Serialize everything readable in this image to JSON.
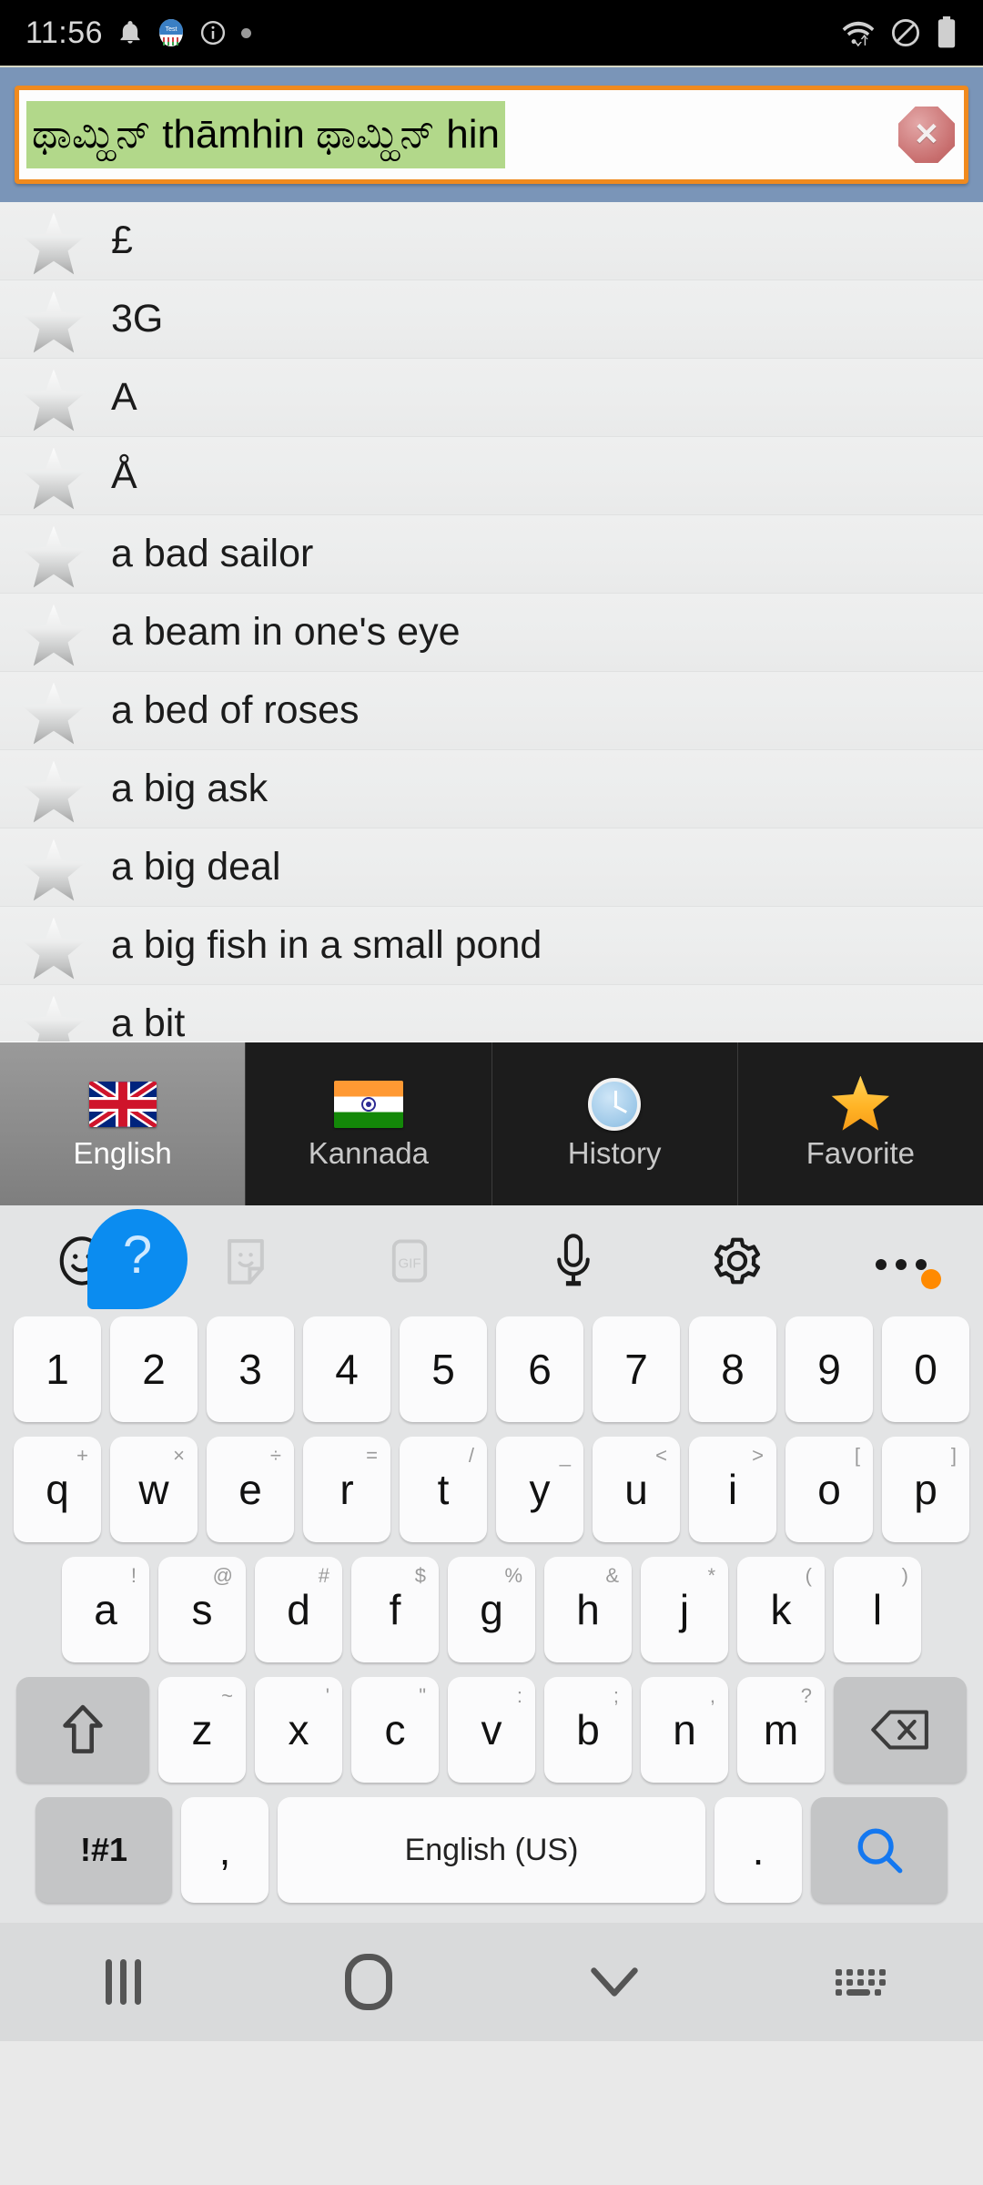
{
  "status_bar": {
    "time": "11:56",
    "icons_left": [
      "bell-icon",
      "test-app-icon",
      "info-icon",
      "dot-icon"
    ],
    "icons_right": [
      "wifi-icon",
      "do-not-disturb-icon",
      "battery-icon"
    ],
    "test_badge_label": "Test"
  },
  "search": {
    "value": "ಥಾಮ್ಹಿನ್  thāmhin ಥಾಮ್ಹಿನ್ hin",
    "clear_icon": "clear-octagon-icon",
    "accent_border": "#f08a1e",
    "header_bg": "#7a95b8",
    "highlight_bg": "#b2d88a"
  },
  "word_list": {
    "items": [
      {
        "label": "£",
        "star": "star-outline-icon"
      },
      {
        "label": "3G",
        "star": "star-outline-icon"
      },
      {
        "label": "A",
        "star": "star-outline-icon"
      },
      {
        "label": "Å",
        "star": "star-outline-icon"
      },
      {
        "label": "a bad sailor",
        "star": "star-outline-icon"
      },
      {
        "label": "a beam in one's eye",
        "star": "star-outline-icon"
      },
      {
        "label": "a bed of roses",
        "star": "star-outline-icon"
      },
      {
        "label": "a big ask",
        "star": "star-outline-icon"
      },
      {
        "label": "a big deal",
        "star": "star-outline-icon"
      },
      {
        "label": "a big fish in a small pond",
        "star": "star-outline-icon"
      },
      {
        "label": "a bit",
        "star": "star-outline-icon"
      }
    ]
  },
  "tabs": [
    {
      "label": "English",
      "icon": "uk-flag-icon",
      "active": true
    },
    {
      "label": "Kannada",
      "icon": "india-flag-icon",
      "active": false
    },
    {
      "label": "History",
      "icon": "clock-icon",
      "active": false
    },
    {
      "label": "Favorite",
      "icon": "gold-star-icon",
      "active": false
    }
  ],
  "help_bubble": {
    "label": "?",
    "color": "#0b8cf0"
  },
  "keyboard": {
    "toolbar": [
      {
        "name": "emoji-icon",
        "state": "enabled"
      },
      {
        "name": "sticker-icon",
        "state": "disabled"
      },
      {
        "name": "gif-icon",
        "state": "disabled",
        "label": "GIF"
      },
      {
        "name": "microphone-icon",
        "state": "enabled"
      },
      {
        "name": "settings-gear-icon",
        "state": "enabled"
      },
      {
        "name": "more-options-icon",
        "state": "enabled",
        "badge": true
      }
    ],
    "row_numbers": [
      "1",
      "2",
      "3",
      "4",
      "5",
      "6",
      "7",
      "8",
      "9",
      "0"
    ],
    "row_q": [
      {
        "key": "q",
        "sup": "+"
      },
      {
        "key": "w",
        "sup": "×"
      },
      {
        "key": "e",
        "sup": "÷"
      },
      {
        "key": "r",
        "sup": "="
      },
      {
        "key": "t",
        "sup": "/"
      },
      {
        "key": "y",
        "sup": "_"
      },
      {
        "key": "u",
        "sup": "<"
      },
      {
        "key": "i",
        "sup": ">"
      },
      {
        "key": "o",
        "sup": "["
      },
      {
        "key": "p",
        "sup": "]"
      }
    ],
    "row_a": [
      {
        "key": "a",
        "sup": "!"
      },
      {
        "key": "s",
        "sup": "@"
      },
      {
        "key": "d",
        "sup": "#"
      },
      {
        "key": "f",
        "sup": "$"
      },
      {
        "key": "g",
        "sup": "%"
      },
      {
        "key": "h",
        "sup": "&"
      },
      {
        "key": "j",
        "sup": "*"
      },
      {
        "key": "k",
        "sup": "("
      },
      {
        "key": "l",
        "sup": ")"
      }
    ],
    "row_z": [
      {
        "key": "z",
        "sup": "~"
      },
      {
        "key": "x",
        "sup": "'"
      },
      {
        "key": "c",
        "sup": "\""
      },
      {
        "key": "v",
        "sup": ":"
      },
      {
        "key": "b",
        "sup": ";"
      },
      {
        "key": "n",
        "sup": ","
      },
      {
        "key": "m",
        "sup": "?"
      }
    ],
    "shift_icon": "shift-arrow-icon",
    "backspace_icon": "backspace-icon",
    "symbols_key": "!#1",
    "comma_key": ",",
    "space_label": "English (US)",
    "period_key": ".",
    "search_icon": "search-magnifier-icon"
  },
  "nav_bar": {
    "recents": "recents-icon",
    "home": "home-icon",
    "hide_keyboard": "chevron-down-icon",
    "keyboard_switch": "keyboard-switch-icon"
  }
}
